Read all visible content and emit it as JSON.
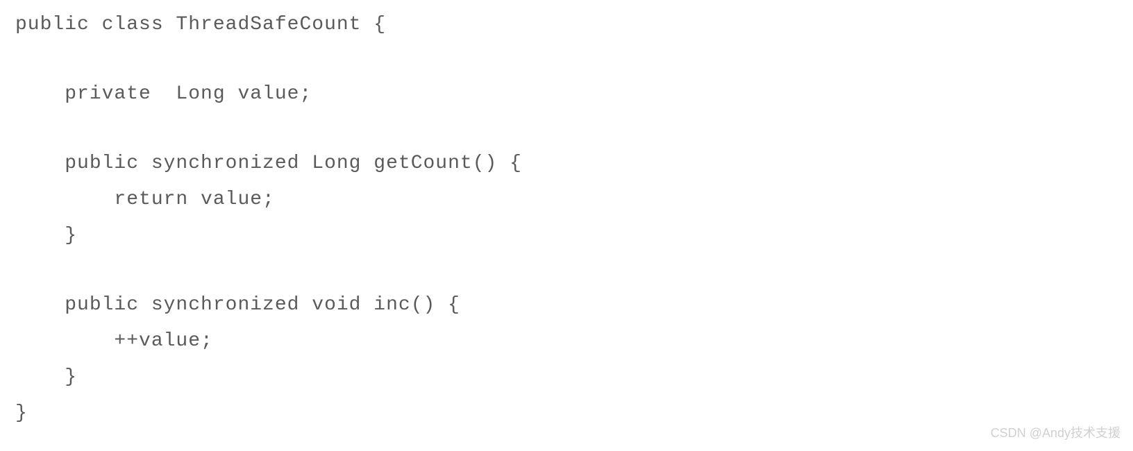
{
  "code": {
    "line1": "public class ThreadSafeCount {",
    "line2": "    private  Long value;",
    "line3": "    public synchronized Long getCount() {",
    "line4": "        return value;",
    "line5": "    }",
    "line6": "    public synchronized void inc() {",
    "line7": "        ++value;",
    "line8": "    }",
    "line9": "}"
  },
  "watermark": "CSDN @Andy技术支援"
}
